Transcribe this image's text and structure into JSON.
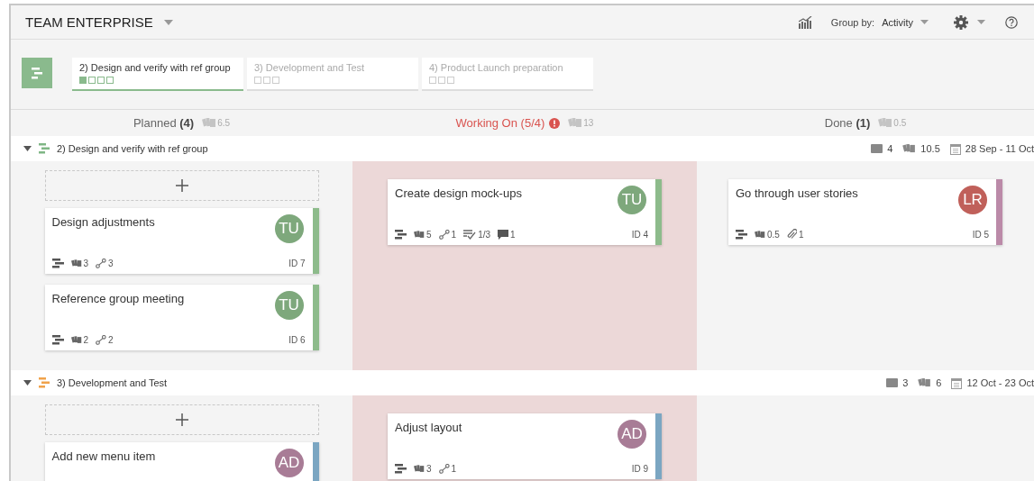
{
  "header": {
    "title": "TEAM ENTERPRISE",
    "group_by_label": "Group by:",
    "group_by_value": "Activity"
  },
  "phases": [
    {
      "label": "2) Design and verify with ref group",
      "selected": true,
      "steps": [
        {
          "done": true
        },
        {
          "done": false
        },
        {
          "done": false
        },
        {
          "done": false
        }
      ]
    },
    {
      "label": "3) Development and Test",
      "selected": false,
      "steps": [
        {
          "done": false
        },
        {
          "done": false
        },
        {
          "done": false
        }
      ]
    },
    {
      "label": "4) Product Launch preparation",
      "selected": false,
      "steps": [
        {
          "done": false
        },
        {
          "done": false
        },
        {
          "done": false
        }
      ]
    }
  ],
  "columns": [
    {
      "name": "Planned",
      "count": "(4)",
      "effort": "6.5",
      "over_limit": false
    },
    {
      "name": "Working On",
      "count": "(5/4)",
      "effort": "13",
      "over_limit": true
    },
    {
      "name": "Done",
      "count": "(1)",
      "effort": "0.5",
      "over_limit": false
    }
  ],
  "lanes": [
    {
      "title": "2) Design and verify with ref group",
      "color": "#7fb685",
      "expanded": true,
      "cards_count": "4",
      "effort": "10.5",
      "dates": "28 Sep - 11 Oct",
      "columns": [
        [
          {
            "title": "Design adjustments",
            "avatar": {
              "initials": "TU",
              "color": "#7ea87c"
            },
            "color": "#8dbb8b",
            "meta": [
              {
                "kind": "effort",
                "text": "3"
              },
              {
                "kind": "links",
                "text": "3"
              }
            ],
            "id": "ID 7"
          },
          {
            "title": "Reference group meeting",
            "avatar": {
              "initials": "TU",
              "color": "#7ea87c"
            },
            "color": "#8dbb8b",
            "meta": [
              {
                "kind": "effort",
                "text": "2"
              },
              {
                "kind": "links",
                "text": "2"
              }
            ],
            "id": "ID 6"
          }
        ],
        [
          {
            "title": "Create design mock-ups",
            "avatar": {
              "initials": "TU",
              "color": "#7ea87c"
            },
            "color": "#8dbb8b",
            "meta": [
              {
                "kind": "effort",
                "text": "5"
              },
              {
                "kind": "links",
                "text": "1"
              },
              {
                "kind": "checklist",
                "text": "1/3"
              },
              {
                "kind": "comments",
                "text": "1"
              }
            ],
            "id": "ID 4"
          }
        ],
        [
          {
            "title": "Go through user stories",
            "avatar": {
              "initials": "LR",
              "color": "#c0605a"
            },
            "color": "#bb8aa8",
            "meta": [
              {
                "kind": "effort",
                "text": "0.5"
              },
              {
                "kind": "attachments",
                "text": "1"
              }
            ],
            "id": "ID 5"
          }
        ]
      ]
    },
    {
      "title": "3) Development and Test",
      "color": "#f0a24a",
      "expanded": true,
      "cards_count": "3",
      "effort": "6",
      "dates": "12 Oct - 23 Oct",
      "columns": [
        [
          {
            "title": "Add new menu item",
            "avatar": {
              "initials": "AD",
              "color": "#a87c96"
            },
            "color": "#7ba6c2"
          }
        ],
        [
          {
            "title": "Adjust layout",
            "avatar": {
              "initials": "AD",
              "color": "#a87c96"
            },
            "color": "#7ba6c2",
            "meta": [
              {
                "kind": "effort",
                "text": "3"
              },
              {
                "kind": "links",
                "text": "1"
              }
            ],
            "id": "ID 9"
          }
        ],
        []
      ]
    }
  ]
}
